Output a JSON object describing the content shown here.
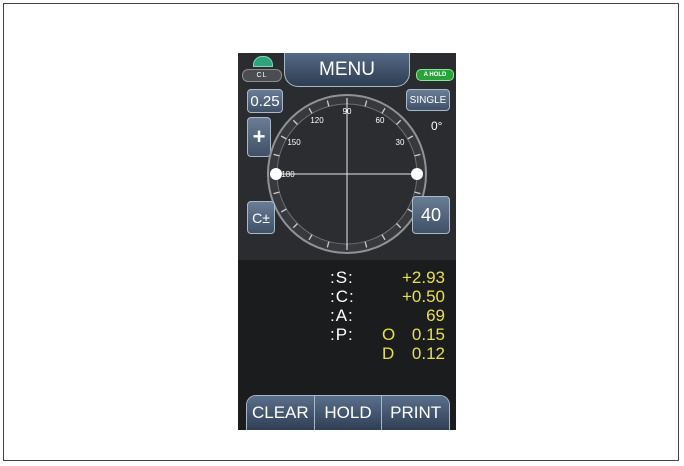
{
  "header": {
    "menu_label": "MENU",
    "cl_label": "CL",
    "cl_dome_icon": "dome-icon",
    "a_hold_badge": "A HOLD",
    "accent": "#27a33a"
  },
  "controls": {
    "step_value": "0.25",
    "mode_label": "SINGLE",
    "plus_icon": "cross-plus-icon",
    "plus_label": "+",
    "cyl_toggle_label": "C±",
    "value_40": "40",
    "angle_readout": "0°"
  },
  "wheel": {
    "tick_labels": [
      "90",
      "60",
      "30",
      "120",
      "150",
      "180"
    ]
  },
  "results": {
    "rows": [
      {
        "label": ":S:",
        "value": "+2.93"
      },
      {
        "label": ":C:",
        "value": "+0.50"
      },
      {
        "label": ":A:",
        "value": "69"
      },
      {
        "label": ":P:",
        "prefix": "O",
        "value": "0.15"
      },
      {
        "label": "",
        "prefix": "D",
        "value": "0.12"
      }
    ],
    "value_color": "#e6e04a"
  },
  "footer": {
    "clear_label": "CLEAR",
    "hold_label": "HOLD",
    "print_label": "PRINT"
  }
}
